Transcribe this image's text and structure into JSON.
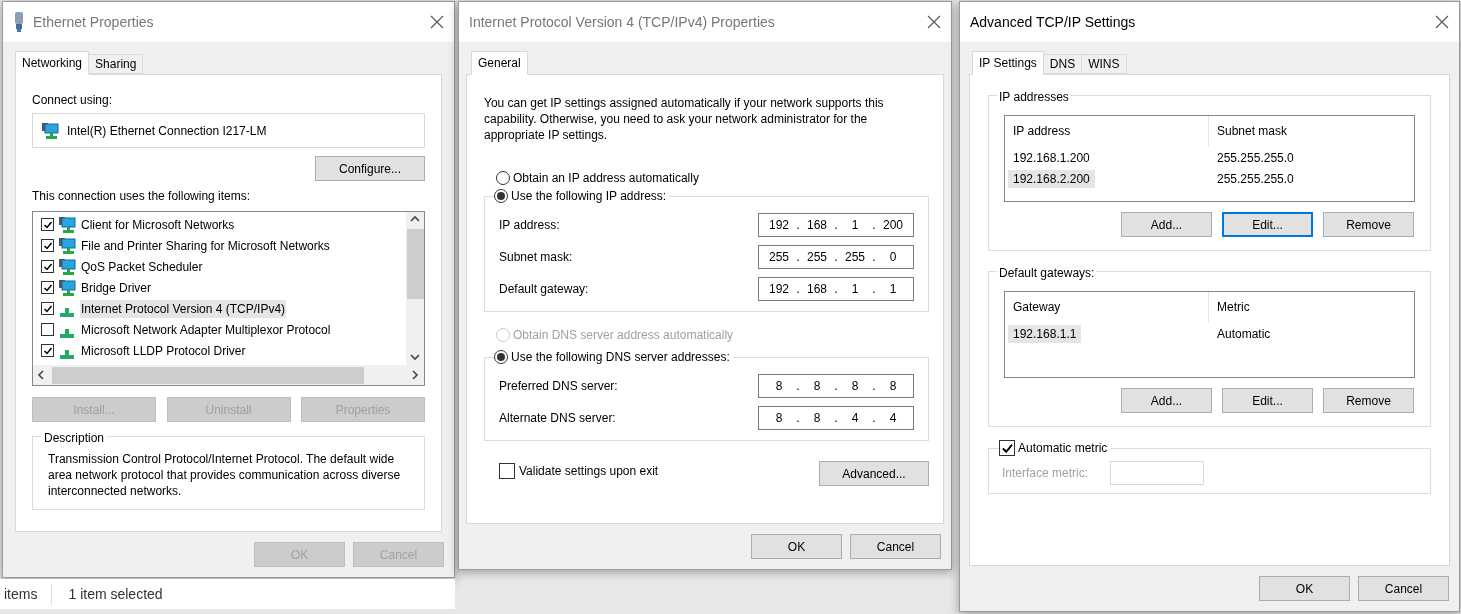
{
  "status_bar": {
    "items": [
      "items",
      "1 item selected"
    ]
  },
  "ethernet": {
    "title": "Ethernet Properties",
    "tabs": [
      {
        "label": "Networking",
        "selected": true
      },
      {
        "label": "Sharing",
        "selected": false
      }
    ],
    "connect_label": "Connect using:",
    "adapter": "Intel(R) Ethernet Connection I217-LM",
    "configure": "Configure...",
    "items_label": "This connection uses the following items:",
    "items": [
      {
        "label": "Client for Microsoft Networks",
        "checked": true,
        "selected": false,
        "kind": "service"
      },
      {
        "label": "File and Printer Sharing for Microsoft Networks",
        "checked": true,
        "selected": false,
        "kind": "service"
      },
      {
        "label": "QoS Packet Scheduler",
        "checked": true,
        "selected": false,
        "kind": "service"
      },
      {
        "label": "Bridge Driver",
        "checked": true,
        "selected": false,
        "kind": "service"
      },
      {
        "label": "Internet Protocol Version 4 (TCP/IPv4)",
        "checked": true,
        "selected": true,
        "kind": "protocol"
      },
      {
        "label": "Microsoft Network Adapter Multiplexor Protocol",
        "checked": false,
        "selected": false,
        "kind": "protocol"
      },
      {
        "label": "Microsoft LLDP Protocol Driver",
        "checked": true,
        "selected": false,
        "kind": "protocol"
      }
    ],
    "buttons": [
      {
        "label": "Install...",
        "disabled": true
      },
      {
        "label": "Uninstall",
        "disabled": true
      },
      {
        "label": "Properties",
        "disabled": true
      }
    ],
    "description": {
      "legend": "Description",
      "text": "Transmission Control Protocol/Internet Protocol. The default wide area network protocol that provides communication across diverse interconnected networks."
    },
    "footer_buttons": [
      {
        "label": "OK",
        "disabled": true
      },
      {
        "label": "Cancel",
        "disabled": true
      }
    ]
  },
  "ipv4": {
    "title": "Internet Protocol Version 4 (TCP/IPv4) Properties",
    "tabs": [
      {
        "label": "General",
        "selected": true
      }
    ],
    "intro": "You can get IP settings assigned automatically if your network supports this capability. Otherwise, you need to ask your network administrator for the appropriate IP settings.",
    "separator": ".",
    "ip_auto": {
      "label": "Obtain an IP address automatically",
      "selected": false,
      "disabled": false
    },
    "ip_manual": {
      "label": "Use the following IP address:",
      "selected": true,
      "disabled": false
    },
    "ip_fields": [
      {
        "label": "IP address:",
        "octets": [
          "192",
          "168",
          "1",
          "200"
        ]
      },
      {
        "label": "Subnet mask:",
        "octets": [
          "255",
          "255",
          "255",
          "0"
        ]
      },
      {
        "label": "Default gateway:",
        "octets": [
          "192",
          "168",
          "1",
          "1"
        ]
      }
    ],
    "dns_auto": {
      "label": "Obtain DNS server address automatically",
      "selected": false,
      "disabled": true
    },
    "dns_manual": {
      "label": "Use the following DNS server addresses:",
      "selected": true,
      "disabled": false
    },
    "dns_fields": [
      {
        "label": "Preferred DNS server:",
        "octets": [
          "8",
          "8",
          "8",
          "8"
        ]
      },
      {
        "label": "Alternate DNS server:",
        "octets": [
          "8",
          "8",
          "4",
          "4"
        ]
      }
    ],
    "validate": {
      "label": "Validate settings upon exit",
      "checked": false
    },
    "advanced": "Advanced...",
    "footer_buttons": [
      {
        "label": "OK",
        "disabled": false
      },
      {
        "label": "Cancel",
        "disabled": false
      }
    ]
  },
  "advanced": {
    "title": "Advanced TCP/IP Settings",
    "tabs": [
      {
        "label": "IP Settings",
        "selected": true
      },
      {
        "label": "DNS",
        "selected": false
      },
      {
        "label": "WINS",
        "selected": false
      }
    ],
    "groups": [
      {
        "legend": "IP addresses",
        "columns": [
          "IP address",
          "Subnet mask"
        ],
        "rows": [
          {
            "cells": [
              "192.168.1.200",
              "255.255.255.0"
            ],
            "selected": false
          },
          {
            "cells": [
              "192.168.2.200",
              "255.255.255.0"
            ],
            "selected": true
          }
        ],
        "buttons": [
          {
            "label": "Add...",
            "focused": false
          },
          {
            "label": "Edit...",
            "focused": true
          },
          {
            "label": "Remove",
            "focused": false
          }
        ]
      },
      {
        "legend": "Default gateways:",
        "columns": [
          "Gateway",
          "Metric"
        ],
        "rows": [
          {
            "cells": [
              "192.168.1.1",
              "Automatic"
            ],
            "selected": true
          }
        ],
        "buttons": [
          {
            "label": "Add...",
            "focused": false
          },
          {
            "label": "Edit...",
            "focused": false
          },
          {
            "label": "Remove",
            "focused": false
          }
        ]
      }
    ],
    "metric": {
      "label": "Automatic metric",
      "checked": true,
      "field_label": "Interface metric:",
      "disabled": true
    },
    "footer_buttons": [
      {
        "label": "OK",
        "disabled": false
      },
      {
        "label": "Cancel",
        "disabled": false
      }
    ]
  }
}
